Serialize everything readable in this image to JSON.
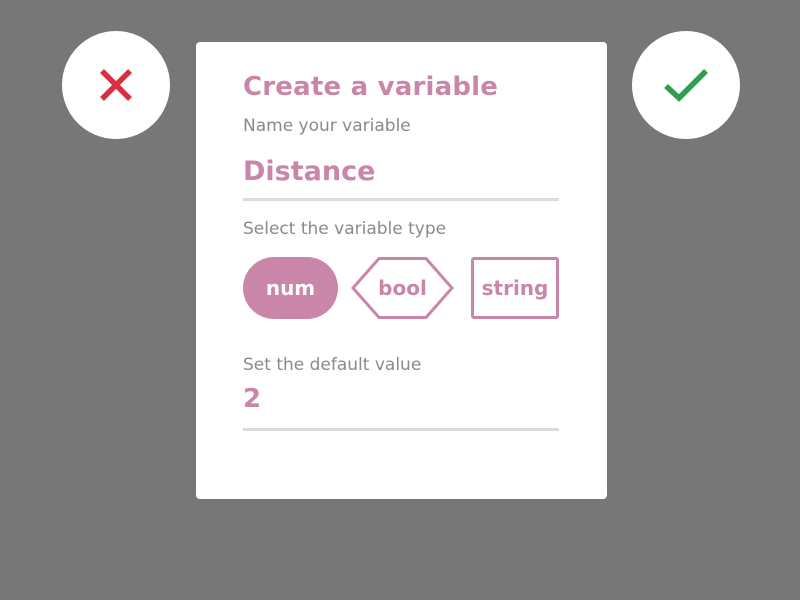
{
  "dialog": {
    "title": "Create a variable",
    "name_label": "Name your variable",
    "name_value": "Distance",
    "type_label": "Select the variable type",
    "types": [
      {
        "label": "num",
        "selected": true
      },
      {
        "label": "bool",
        "selected": false
      },
      {
        "label": "string",
        "selected": false
      }
    ],
    "default_label": "Set the default value",
    "default_value": "2"
  },
  "actions": {
    "cancel_icon": "close-icon",
    "confirm_icon": "check-icon"
  },
  "colors": {
    "background": "#777777",
    "accent": "#c986a8",
    "cancel": "#d9303f",
    "confirm": "#2e9e4f",
    "label": "#8a8a8a",
    "underline": "#dcdcdc"
  }
}
